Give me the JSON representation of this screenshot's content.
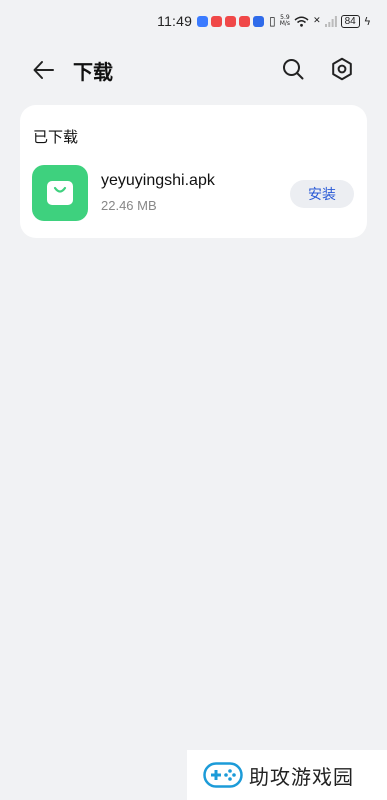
{
  "status_bar": {
    "time": "11:49",
    "net_speed_value": "5.9",
    "net_speed_unit": "M/s",
    "battery": "84"
  },
  "header": {
    "title": "下载"
  },
  "downloads": {
    "section_title": "已下载",
    "items": [
      {
        "file_name": "yeyuyingshi.apk",
        "file_size": "22.46 MB",
        "action_label": "安装",
        "icon_color": "#3ed17e"
      }
    ]
  },
  "watermark": {
    "text": "助攻游戏园"
  },
  "colors": {
    "background": "#f1f2f4",
    "card": "#ffffff",
    "accent": "#2a5ad6",
    "app_icon": "#3ed17e"
  }
}
